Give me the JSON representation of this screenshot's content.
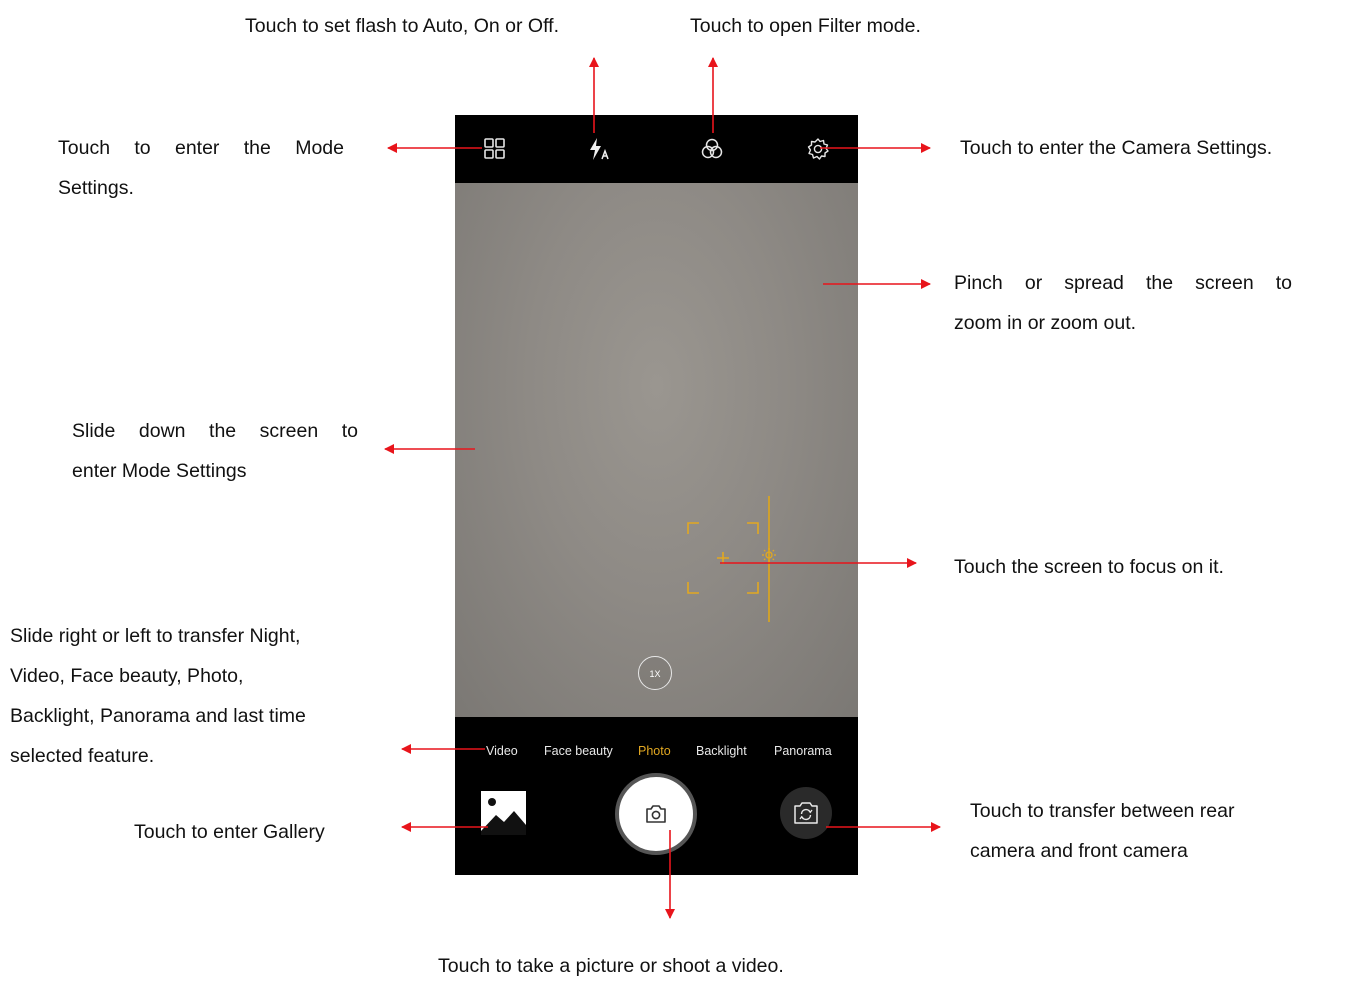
{
  "annotations": {
    "flash": "Touch to set flash to Auto, On or Off.",
    "filter": "Touch to open Filter mode.",
    "mode_settings_line1": "Touch to enter the Mode",
    "mode_settings_line2": "Settings.",
    "camera_settings": "Touch to enter the Camera Settings.",
    "zoom_line1": "Pinch or spread the screen to",
    "zoom_line2": "zoom in or zoom out.",
    "slide_down_line1": "Slide down the screen to",
    "slide_down_line2": "enter Mode Settings",
    "focus": "Touch the screen to focus on it.",
    "slide_modes_line1": "Slide right or left to transfer Night,",
    "slide_modes_line2": "Video, Face beauty, Photo,",
    "slide_modes_line3": "Backlight, Panorama and last time",
    "slide_modes_line4": "selected feature.",
    "gallery": "Touch to enter Gallery",
    "switch_line1": "Touch to transfer between rear",
    "switch_line2": "camera and front camera",
    "shutter": "Touch to take a picture or shoot a video."
  },
  "camera": {
    "icons": {
      "mode_settings": "grid-icon",
      "flash": "flash-auto-icon",
      "filter": "filter-icon",
      "settings": "gear-icon",
      "gallery": "image-icon",
      "shutter": "camera-icon",
      "switch": "camera-switch-icon"
    },
    "zoom_label": "1X",
    "modes": [
      "Video",
      "Face beauty",
      "Photo",
      "Backlight",
      "Panorama"
    ],
    "active_mode": "Photo"
  },
  "colors": {
    "arrow": "#e8141b",
    "focus": "#e2a821",
    "active_mode": "#e2a821"
  }
}
